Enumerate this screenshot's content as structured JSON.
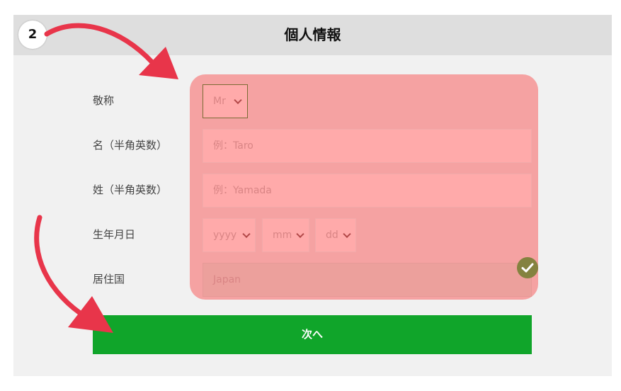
{
  "header": {
    "title": "個人情報",
    "step_number": "2"
  },
  "form": {
    "title_label": "敬称",
    "title_value": "Mr",
    "first_name_label": "名（半角英数）",
    "first_name_placeholder": "例：Taro",
    "last_name_label": "姓（半角英数）",
    "last_name_placeholder": "例：Yamada",
    "birthdate_label": "生年月日",
    "birth_year": "yyyy",
    "birth_month": "mm",
    "birth_day": "dd",
    "country_label": "居住国",
    "country_value": "Japan"
  },
  "actions": {
    "next_label": "次へ"
  },
  "colors": {
    "panel_bg": "#f1f1f1",
    "header_bg": "#dedede",
    "highlight": "#f87878",
    "next_button": "#10a52a",
    "annotation_arrow": "#e8354a",
    "check_badge": "#84823f"
  }
}
